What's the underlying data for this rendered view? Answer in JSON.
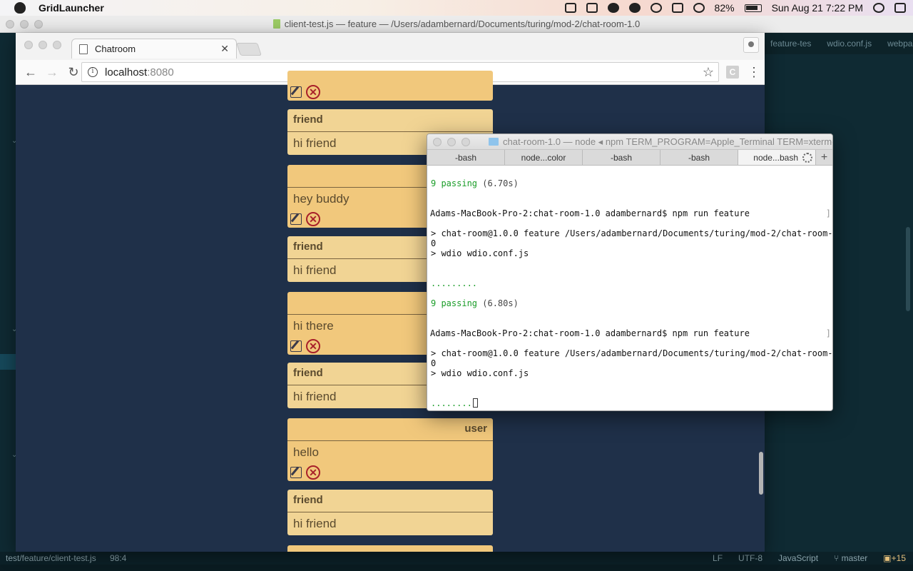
{
  "menubar": {
    "app_name": "GridLauncher",
    "battery": "82%",
    "datetime": "Sun Aug 21  7:22 PM"
  },
  "editor": {
    "title": "client-test.js — feature — /Users/adambernard/Documents/turing/mod-2/chat-room-1.0",
    "tabs": [
      "feature-tes",
      "wdio.conf.js",
      "webpa"
    ],
    "status": {
      "path": "test/feature/client-test.js",
      "cursor": "98:4",
      "eol": "LF",
      "encoding": "UTF-8",
      "grammar": "JavaScript",
      "branch": "master",
      "updates": "+15"
    }
  },
  "browser": {
    "tab_title": "Chatroom",
    "url_host": "localhost",
    "url_port": ":8080",
    "extension_letter": "C"
  },
  "chat": {
    "messages": [
      {
        "type": "own",
        "author": "",
        "text": "",
        "editable": true
      },
      {
        "type": "friend",
        "author": "friend",
        "text": "hi friend",
        "editable": false
      },
      {
        "type": "own",
        "author": "",
        "text": "hey buddy",
        "editable": true
      },
      {
        "type": "friend",
        "author": "friend",
        "text": "hi friend",
        "editable": false
      },
      {
        "type": "own",
        "author": "",
        "text": "hi there",
        "editable": true
      },
      {
        "type": "friend",
        "author": "friend",
        "text": "hi friend",
        "editable": false
      },
      {
        "type": "own",
        "author": "user",
        "text": "hello",
        "editable": true
      },
      {
        "type": "friend",
        "author": "friend",
        "text": "hi friend",
        "editable": false
      }
    ]
  },
  "terminal": {
    "title": "chat-room-1.0 — node ◂ npm TERM_PROGRAM=Apple_Terminal TERM=xterm-...",
    "tabs": [
      "-bash",
      "node...color",
      "-bash",
      "-bash",
      "node...bash"
    ],
    "lines": {
      "l1": "9 passing",
      "l1b": " (6.70s)",
      "l2": "Adams-MacBook-Pro-2:chat-room-1.0 adambernard$ npm run feature",
      "l3": "> chat-room@1.0.0 feature /Users/adambernard/Documents/turing/mod-2/chat-room-1.",
      "l3b": "0",
      "l4": "> wdio wdio.conf.js",
      "l5": ".........",
      "l6": "9 passing",
      "l6b": " (6.80s)",
      "l7": "Adams-MacBook-Pro-2:chat-room-1.0 adambernard$ npm run feature",
      "l8": "> chat-room@1.0.0 feature /Users/adambernard/Documents/turing/mod-2/chat-room-1.",
      "l8b": "0",
      "l9": "> wdio wdio.conf.js",
      "l10": "........"
    }
  }
}
